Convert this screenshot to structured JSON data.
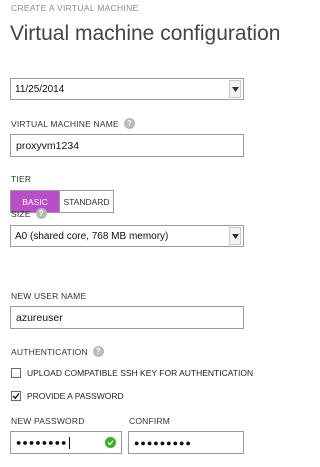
{
  "header": {
    "eyebrow": "CREATE A VIRTUAL MACHINE",
    "title": "Virtual machine configuration"
  },
  "version_date": {
    "value": "11/25/2014"
  },
  "vm_name": {
    "label": "VIRTUAL MACHINE NAME",
    "value": "proxyvm1234"
  },
  "tier": {
    "label": "TIER",
    "options": [
      "BASIC",
      "STANDARD"
    ],
    "selected": "BASIC"
  },
  "size": {
    "label": "SIZE",
    "value": "A0 (shared core, 768 MB memory)"
  },
  "user_name": {
    "label": "NEW USER NAME",
    "value": "azureuser"
  },
  "authentication": {
    "label": "AUTHENTICATION",
    "ssh_option": {
      "label": "UPLOAD COMPATIBLE SSH KEY FOR AUTHENTICATION",
      "checked": false
    },
    "password_option": {
      "label": "PROVIDE A PASSWORD",
      "checked": true
    }
  },
  "password": {
    "label": "NEW PASSWORD",
    "masked": "●●●●●●●●",
    "valid": true
  },
  "confirm": {
    "label": "CONFIRM",
    "masked": "●●●●●●●●●"
  },
  "icons": {
    "help": "help-icon",
    "dropdown": "chevron-down-icon",
    "valid": "checkmark-circle-icon",
    "checked": "checkmark-icon"
  },
  "colors": {
    "accent": "#b94fc8",
    "valid": "#3fae29"
  }
}
